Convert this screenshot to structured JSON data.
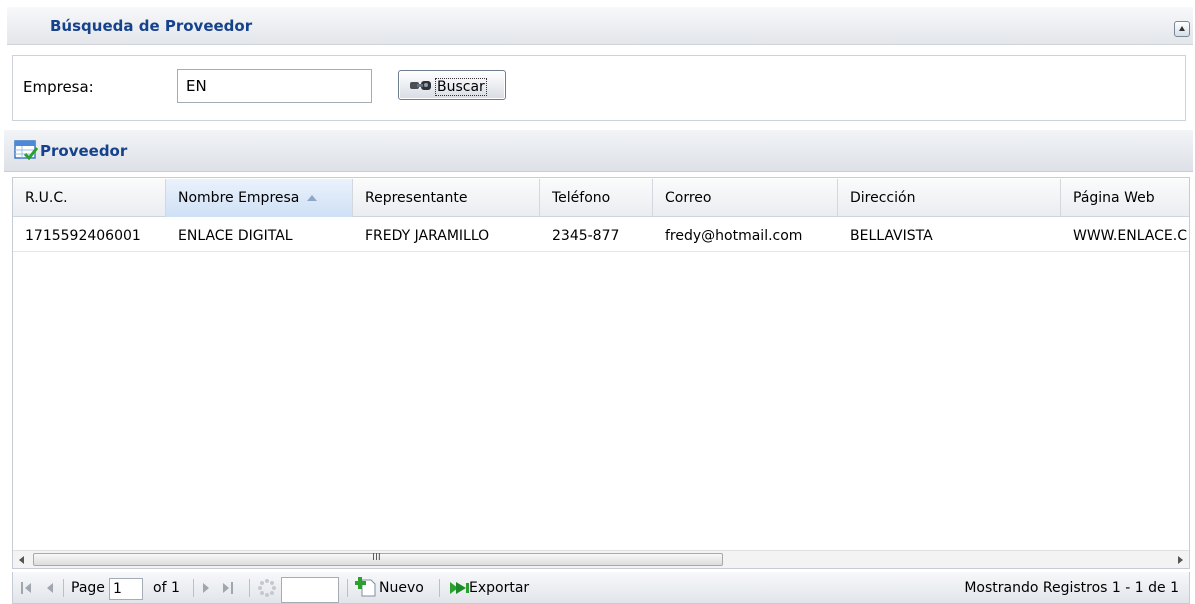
{
  "search_panel": {
    "title": "Búsqueda de Proveedor",
    "empresa_label": "Empresa:",
    "empresa_value": "EN",
    "buscar_label": "Buscar"
  },
  "grid_panel": {
    "title": "Proveedor",
    "columns": [
      "R.U.C.",
      "Nombre Empresa",
      "Representante",
      "Teléfono",
      "Correo",
      "Dirección",
      "Página Web"
    ],
    "sorted_column": "Nombre Empresa",
    "rows": [
      [
        "1715592406001",
        "ENLACE DIGITAL",
        "FREDY JARAMILLO",
        "2345-877",
        "fredy@hotmail.com",
        "BELLAVISTA",
        "WWW.ENLACE.C"
      ]
    ]
  },
  "paging": {
    "page_label": "Page",
    "page_value": "1",
    "of_label": "of 1",
    "nuevo_label": "Nuevo",
    "exportar_label": "Exportar",
    "status": "Mostrando Registros 1 - 1 de 1"
  },
  "icons": {
    "buscar": "binoculars-icon",
    "grid": "table-check-icon",
    "nuevo": "add-page-icon",
    "exportar": "export-icon",
    "refresh": "refresh-icon"
  },
  "colors": {
    "title_text": "#15428b",
    "sorted_header": "#cfe0f5"
  }
}
